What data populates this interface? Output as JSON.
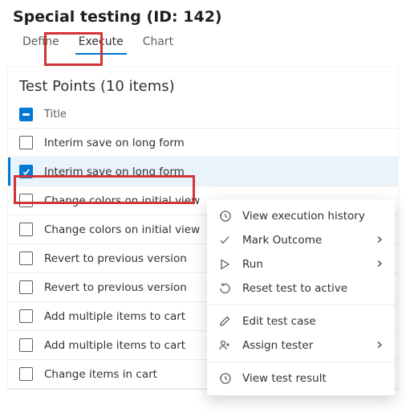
{
  "header": {
    "title": "Special testing (ID: 142)"
  },
  "tabs": {
    "items": [
      {
        "label": "Define",
        "active": false
      },
      {
        "label": "Execute",
        "active": true
      },
      {
        "label": "Chart",
        "active": false
      }
    ]
  },
  "test_points": {
    "title": "Test Points (10 items)",
    "column_label": "Title",
    "rows": [
      {
        "title": "Interim save on long form",
        "checked": false,
        "selected": false
      },
      {
        "title": "Interim save on long form",
        "checked": true,
        "selected": true
      },
      {
        "title": "Change colors on initial view",
        "checked": false,
        "selected": false
      },
      {
        "title": "Change colors on initial view",
        "checked": false,
        "selected": false
      },
      {
        "title": "Revert to previous version",
        "checked": false,
        "selected": false
      },
      {
        "title": "Revert to previous version",
        "checked": false,
        "selected": false
      },
      {
        "title": "Add multiple items to cart",
        "checked": false,
        "selected": false
      },
      {
        "title": "Add multiple items to cart",
        "checked": false,
        "selected": false
      },
      {
        "title": "Change items in cart",
        "checked": false,
        "selected": false
      }
    ]
  },
  "context_menu": {
    "items": [
      {
        "label": "View execution history",
        "icon": "history-icon",
        "sub": false
      },
      {
        "label": "Mark Outcome",
        "icon": "check-icon",
        "sub": true
      },
      {
        "label": "Run",
        "icon": "play-icon",
        "sub": true
      },
      {
        "label": "Reset test to active",
        "icon": "reset-icon",
        "sub": false
      },
      {
        "sep": true
      },
      {
        "label": "Edit test case",
        "icon": "edit-icon",
        "sub": false
      },
      {
        "label": "Assign tester",
        "icon": "assign-icon",
        "sub": true
      },
      {
        "sep": true
      },
      {
        "label": "View test result",
        "icon": "history-icon",
        "sub": false
      }
    ]
  }
}
